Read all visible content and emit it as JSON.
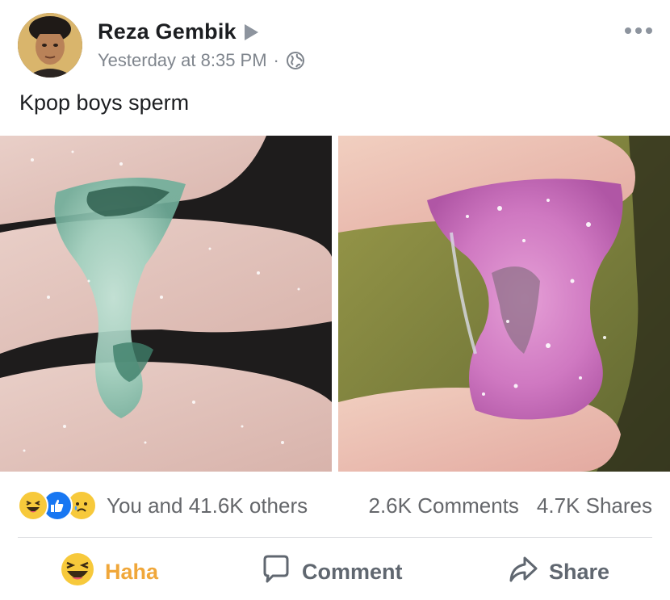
{
  "post": {
    "author": "Reza Gembik",
    "timestamp": "Yesterday at 8:35 PM",
    "separator": "·",
    "privacy_icon": "globe-icon",
    "text": "Kpop boys sperm"
  },
  "reactions": {
    "icons": [
      "haha-reaction-icon",
      "like-reaction-icon",
      "sad-reaction-icon"
    ],
    "summary": "You and 41.6K others",
    "comments": "2.6K Comments",
    "shares": "4.7K Shares"
  },
  "actions": {
    "haha_label": "Haha",
    "comment_label": "Comment",
    "share_label": "Share"
  },
  "colors": {
    "haha_active": "#f0a73a",
    "secondary_text": "#65676b",
    "like_blue": "#1877f2"
  }
}
